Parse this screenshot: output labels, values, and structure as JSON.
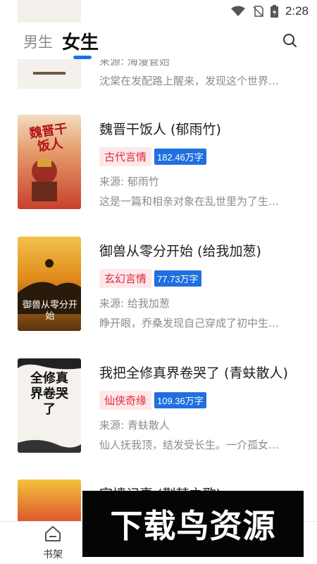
{
  "status": {
    "time": "2:28"
  },
  "tabs": {
    "male": "男生",
    "female": "女生"
  },
  "books": [
    {
      "title": "",
      "genre": "",
      "words": "",
      "source": "来源: 海漫管始",
      "desc": "沈棠在发配路上醒来，发现这个世界…"
    },
    {
      "title": "魏晋干饭人 (郁雨竹)",
      "genre": "古代言情",
      "words": "182.46万字",
      "source": "来源: 郁雨竹",
      "desc": "这是一篇和相亲对象在乱世里为了生…",
      "cover_text": "魏晋干饭人"
    },
    {
      "title": "御兽从零分开始 (给我加葱)",
      "genre": "玄幻言情",
      "words": "77.73万字",
      "source": "来源: 给我加葱",
      "desc": "睁开眼，乔桑发现自己穿成了初中生…",
      "cover_text": "御兽从零分开始"
    },
    {
      "title": "我把全修真界卷哭了 (青蚨散人)",
      "genre": "仙侠奇缘",
      "words": "109.36万字",
      "source": "来源: 青蚨散人",
      "desc": "仙人抚我顶，结发受长生。一介孤女…",
      "cover_text": "全修真界卷哭了"
    },
    {
      "title": "宫墙记事 (荆棘之歌)",
      "genre": "",
      "words": "",
      "source": "",
      "desc": ""
    }
  ],
  "nav": {
    "shelf": "书架"
  },
  "watermark": "下载鸟资源"
}
